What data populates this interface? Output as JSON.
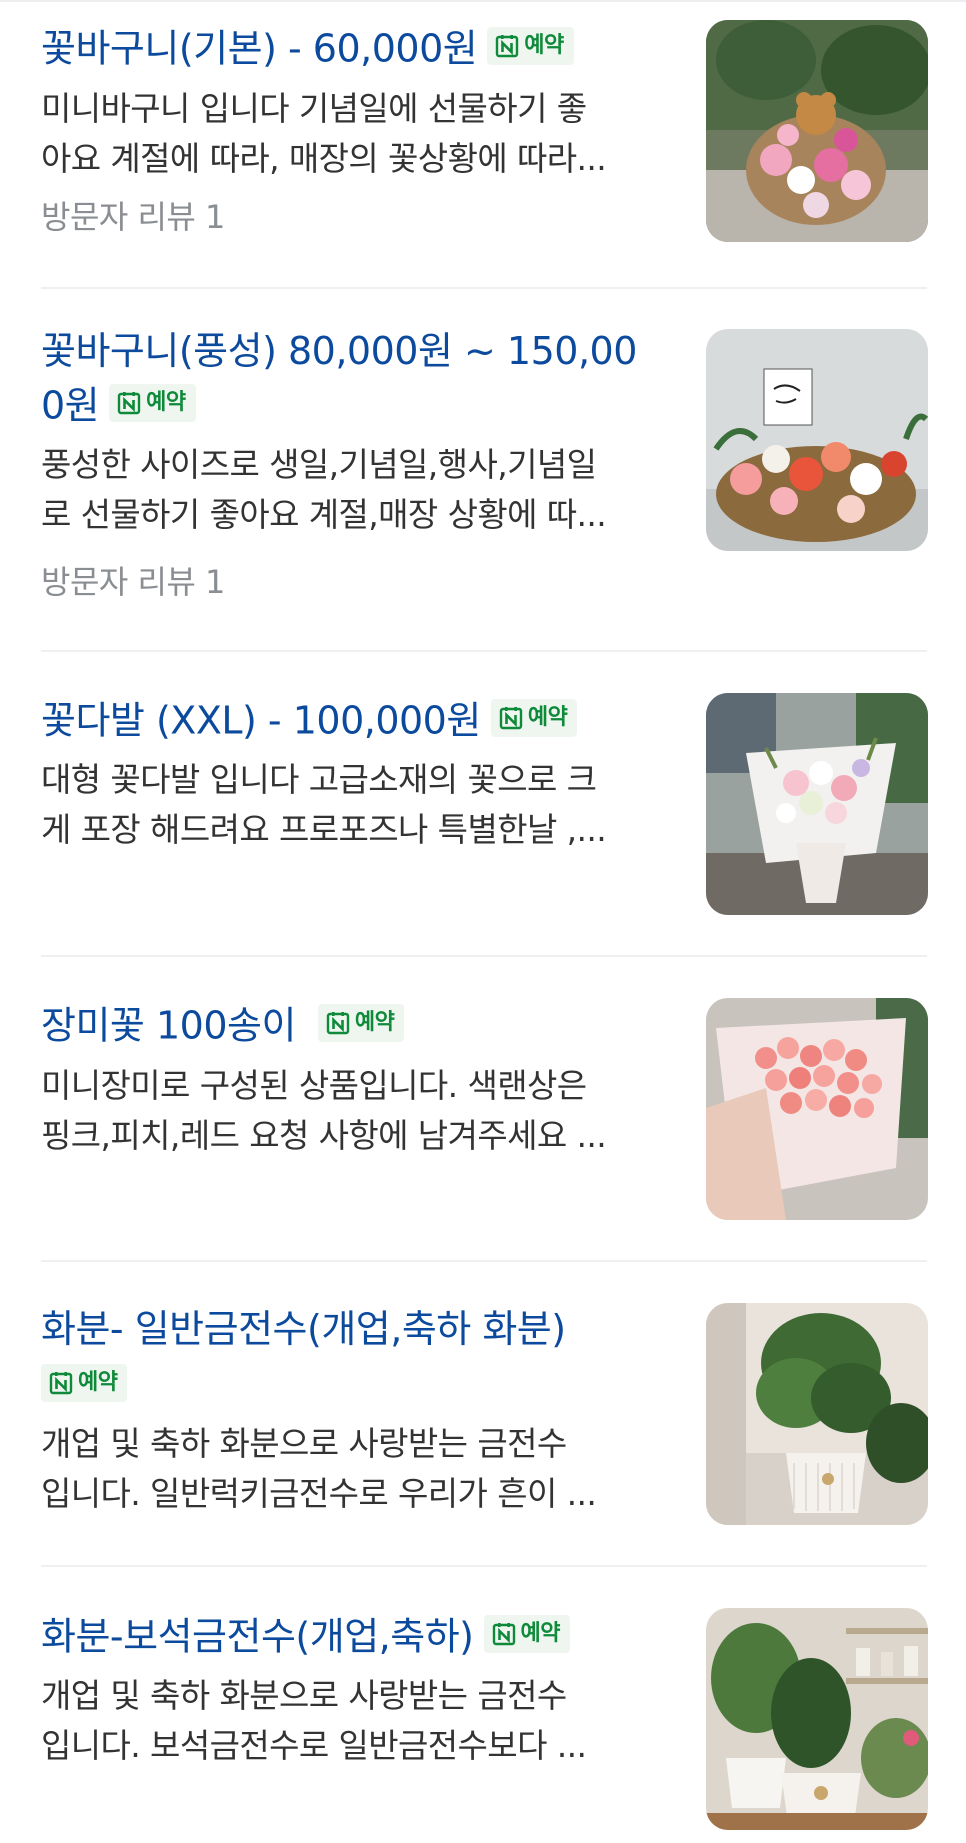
{
  "badge_label": "예약",
  "items": [
    {
      "title_line1": "꽃바구니(기본) - 60,000원",
      "desc_line1": "미니바구니 입니다 기념일에 선물하기 좋",
      "desc_line2": "아요 계절에 따라, 매장의 꽃상황에 따라...",
      "review": "방문자 리뷰 1"
    },
    {
      "title_line1": "꽃바구니(풍성) 80,000원 ~ 150,00",
      "title_line2": "0원",
      "desc_line1": "풍성한 사이즈로 생일,기념일,행사,기념일",
      "desc_line2": "로 선물하기 좋아요 계절,매장 상황에 따...",
      "review": "방문자 리뷰 1"
    },
    {
      "title_line1": "꽃다발 (XXL) - 100,000원",
      "desc_line1": "대형 꽃다발 입니다 고급소재의 꽃으로 크",
      "desc_line2": "게 포장 해드려요 프로포즈나 특별한날 ,..."
    },
    {
      "title_line1": "장미꽃 100송이",
      "desc_line1": "미니장미로 구성된 상품입니다. 색랜상은",
      "desc_line2": "핑크,피치,레드 요청 사항에 남겨주세요 ..."
    },
    {
      "title_line1": "화분- 일반금전수(개업,축하 화분)",
      "desc_line1": "개업 및 축하 화분으로 사랑받는 금전수",
      "desc_line2": "입니다. 일반럭키금전수로 우리가 흔이 ..."
    },
    {
      "title_line1": "화분-보석금전수(개업,축하)",
      "desc_line1": "개업 및 축하 화분으로 사랑받는 금전수",
      "desc_line2": "입니다. 보석금전수로 일반금전수보다 ..."
    }
  ],
  "colors": {
    "title": "#0c4a9e",
    "badge_text": "#0f8a3a",
    "badge_bg": "#eef6ef",
    "desc": "#333333",
    "review": "#8a8d91",
    "divider": "#eef0f2"
  }
}
